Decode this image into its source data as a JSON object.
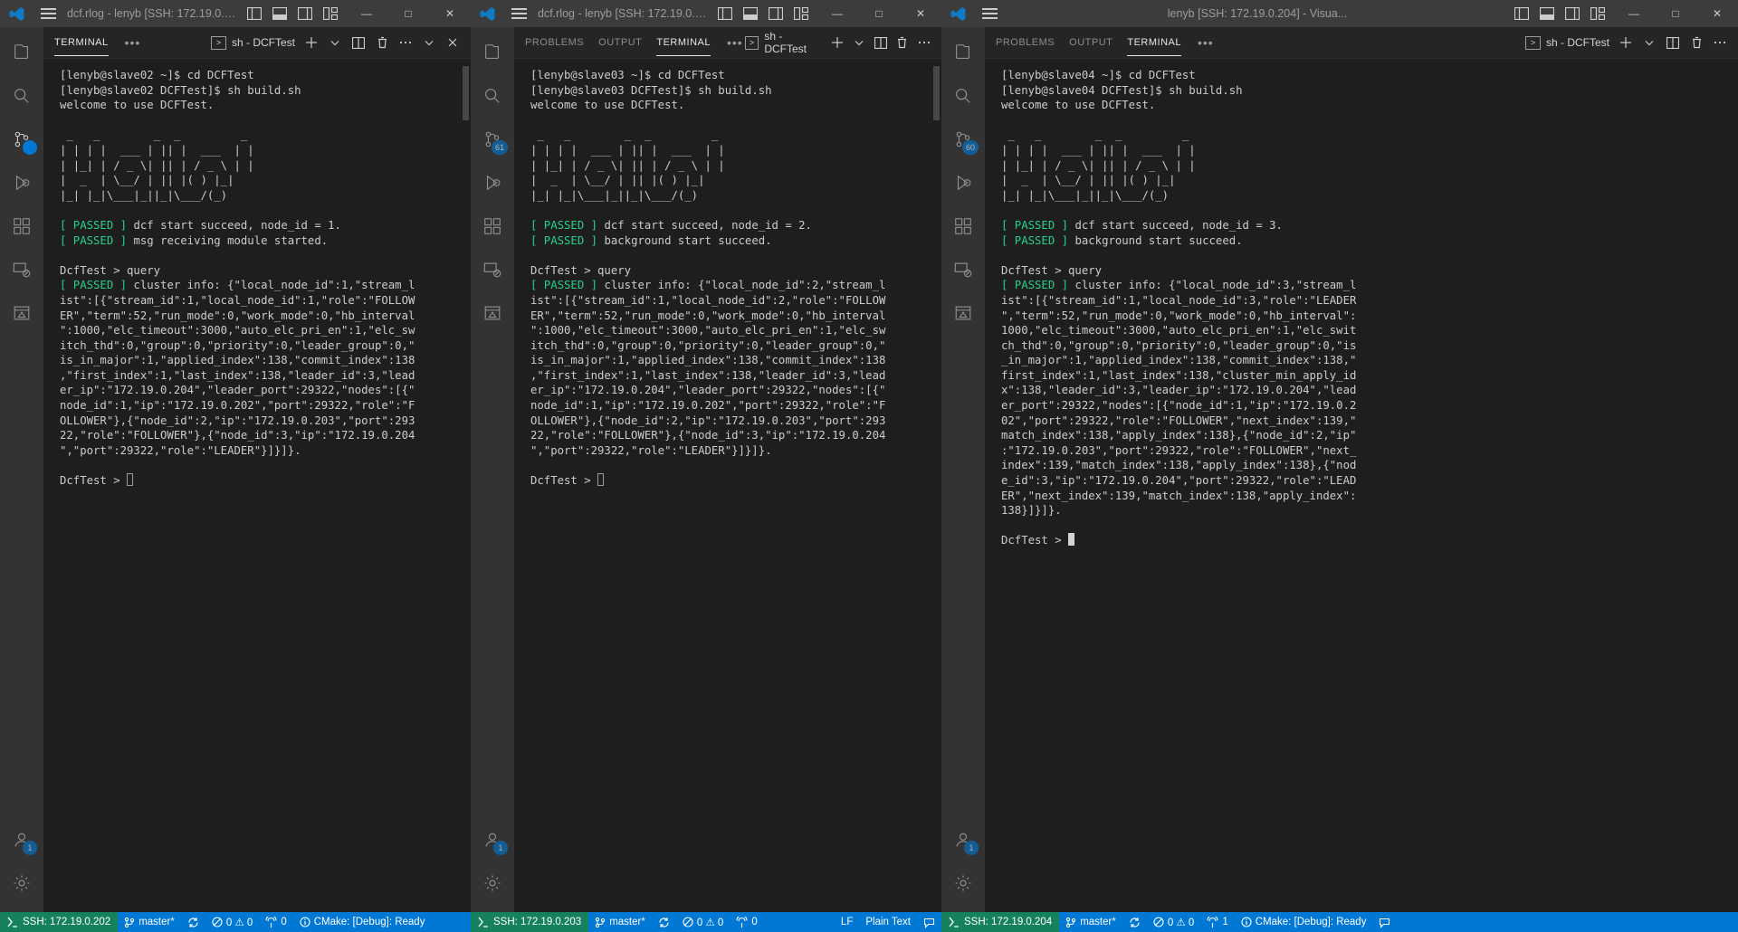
{
  "windows": [
    {
      "id": "win-slave02",
      "title": "dcf.rlog - lenyb [SSH: 172.19.0.20...",
      "panel_tabs": [
        {
          "label": "TERMINAL",
          "active": true
        }
      ],
      "panel_overflow": "•••",
      "shell_label": "sh - DCFTest",
      "terminal": {
        "lines": [
          {
            "gutter": "filled",
            "text": "[lenyb@slave02 ~]$ cd DCFTest"
          },
          {
            "gutter": "hollow",
            "text": "[lenyb@slave02 DCFTest]$ sh build.sh"
          },
          {
            "text": "welcome to use DCFTest."
          },
          {
            "text": ""
          },
          {
            "text": " _   _        _  _         _ "
          },
          {
            "text": "| | | |  ___ | || |  ___  | |"
          },
          {
            "text": "| |_| | / _ \\| || | / _ \\ | |"
          },
          {
            "text": "|  _  | \\__/ | || |( ) |_|"
          },
          {
            "text": "|_| |_|\\___|_||_|\\___/(_)"
          },
          {
            "text": ""
          },
          {
            "passed": true,
            "text": " dcf start succeed, node_id = 1."
          },
          {
            "passed": true,
            "text": " msg receiving module started."
          },
          {
            "text": ""
          },
          {
            "text": "DcfTest > query"
          },
          {
            "passed": true,
            "text": " cluster info: {\"local_node_id\":1,\"stream_l"
          },
          {
            "text": "ist\":[{\"stream_id\":1,\"local_node_id\":1,\"role\":\"FOLLOW"
          },
          {
            "text": "ER\",\"term\":52,\"run_mode\":0,\"work_mode\":0,\"hb_interval"
          },
          {
            "text": "\":1000,\"elc_timeout\":3000,\"auto_elc_pri_en\":1,\"elc_sw"
          },
          {
            "text": "itch_thd\":0,\"group\":0,\"priority\":0,\"leader_group\":0,\""
          },
          {
            "text": "is_in_major\":1,\"applied_index\":138,\"commit_index\":138"
          },
          {
            "text": ",\"first_index\":1,\"last_index\":138,\"leader_id\":3,\"lead"
          },
          {
            "text": "er_ip\":\"172.19.0.204\",\"leader_port\":29322,\"nodes\":[{\""
          },
          {
            "text": "node_id\":1,\"ip\":\"172.19.0.202\",\"port\":29322,\"role\":\"F"
          },
          {
            "text": "OLLOWER\"},{\"node_id\":2,\"ip\":\"172.19.0.203\",\"port\":293"
          },
          {
            "text": "22,\"role\":\"FOLLOWER\"},{\"node_id\":3,\"ip\":\"172.19.0.204"
          },
          {
            "text": "\",\"port\":29322,\"role\":\"LEADER\"}]}]}."
          },
          {
            "text": ""
          },
          {
            "prompt": "DcfTest > ",
            "cursor": "outline"
          }
        ]
      },
      "status": {
        "remote": "SSH: 172.19.0.202",
        "items": [
          {
            "name": "branch",
            "label": "master*"
          },
          {
            "name": "sync",
            "label": ""
          },
          {
            "name": "problems",
            "label": "0 ⚠ 0"
          },
          {
            "name": "ports",
            "label": "0"
          },
          {
            "name": "cmake",
            "label": "CMake: [Debug]: Ready"
          }
        ]
      }
    },
    {
      "id": "win-slave03",
      "title": "dcf.rlog - lenyb [SSH: 172.19.0.20...",
      "panel_tabs": [
        {
          "label": "PROBLEMS",
          "active": false
        },
        {
          "label": "OUTPUT",
          "active": false
        },
        {
          "label": "TERMINAL",
          "active": true
        }
      ],
      "panel_overflow": "•••",
      "shell_label": "sh - DCFTest",
      "scm_badge": "61",
      "terminal": {
        "lines": [
          {
            "gutter": "filled",
            "text": "[lenyb@slave03 ~]$ cd DCFTest"
          },
          {
            "gutter": "hollow",
            "text": "[lenyb@slave03 DCFTest]$ sh build.sh"
          },
          {
            "text": "welcome to use DCFTest."
          },
          {
            "text": ""
          },
          {
            "text": " _   _        _  _         _ "
          },
          {
            "text": "| | | |  ___ | || |  ___  | |"
          },
          {
            "text": "| |_| | / _ \\| || | / _ \\ | |"
          },
          {
            "text": "|  _  | \\__/ | || |( ) |_|"
          },
          {
            "text": "|_| |_|\\___|_||_|\\___/(_)"
          },
          {
            "text": ""
          },
          {
            "passed": true,
            "text": " dcf start succeed, node_id = 2."
          },
          {
            "passed": true,
            "text": " background start succeed."
          },
          {
            "text": ""
          },
          {
            "text": "DcfTest > query"
          },
          {
            "passed": true,
            "text": " cluster info: {\"local_node_id\":2,\"stream_l"
          },
          {
            "text": "ist\":[{\"stream_id\":1,\"local_node_id\":2,\"role\":\"FOLLOW"
          },
          {
            "text": "ER\",\"term\":52,\"run_mode\":0,\"work_mode\":0,\"hb_interval"
          },
          {
            "text": "\":1000,\"elc_timeout\":3000,\"auto_elc_pri_en\":1,\"elc_sw"
          },
          {
            "text": "itch_thd\":0,\"group\":0,\"priority\":0,\"leader_group\":0,\""
          },
          {
            "text": "is_in_major\":1,\"applied_index\":138,\"commit_index\":138"
          },
          {
            "text": ",\"first_index\":1,\"last_index\":138,\"leader_id\":3,\"lead"
          },
          {
            "text": "er_ip\":\"172.19.0.204\",\"leader_port\":29322,\"nodes\":[{\""
          },
          {
            "text": "node_id\":1,\"ip\":\"172.19.0.202\",\"port\":29322,\"role\":\"F"
          },
          {
            "text": "OLLOWER\"},{\"node_id\":2,\"ip\":\"172.19.0.203\",\"port\":293"
          },
          {
            "text": "22,\"role\":\"FOLLOWER\"},{\"node_id\":3,\"ip\":\"172.19.0.204"
          },
          {
            "text": "\",\"port\":29322,\"role\":\"LEADER\"}]}]}."
          },
          {
            "text": ""
          },
          {
            "prompt": "DcfTest > ",
            "cursor": "outline"
          }
        ]
      },
      "status": {
        "remote": "SSH: 172.19.0.203",
        "items": [
          {
            "name": "branch",
            "label": "master*"
          },
          {
            "name": "sync",
            "label": ""
          },
          {
            "name": "problems",
            "label": "0 ⚠ 0"
          },
          {
            "name": "ports",
            "label": "0"
          }
        ],
        "right_items": [
          {
            "name": "eol",
            "label": "LF"
          },
          {
            "name": "language",
            "label": "Plain Text"
          },
          {
            "name": "feedback",
            "label": ""
          }
        ]
      }
    },
    {
      "id": "win-slave04",
      "title": "lenyb [SSH: 172.19.0.204] - Visua...",
      "panel_tabs": [
        {
          "label": "PROBLEMS",
          "active": false
        },
        {
          "label": "OUTPUT",
          "active": false
        },
        {
          "label": "TERMINAL",
          "active": true
        }
      ],
      "panel_overflow": "•••",
      "shell_label": "sh - DCFTest",
      "scm_badge": "60",
      "terminal": {
        "lines": [
          {
            "gutter": "filled",
            "text": "[lenyb@slave04 ~]$ cd DCFTest"
          },
          {
            "gutter": "hollow",
            "text": "[lenyb@slave04 DCFTest]$ sh build.sh"
          },
          {
            "text": "welcome to use DCFTest."
          },
          {
            "text": ""
          },
          {
            "text": " _   _        _  _         _ "
          },
          {
            "text": "| | | |  ___ | || |  ___  | |"
          },
          {
            "text": "| |_| | / _ \\| || | / _ \\ | |"
          },
          {
            "text": "|  _  | \\__/ | || |( ) |_|"
          },
          {
            "text": "|_| |_|\\___|_||_|\\___/(_)"
          },
          {
            "text": ""
          },
          {
            "passed": true,
            "text": " dcf start succeed, node_id = 3."
          },
          {
            "passed": true,
            "text": " background start succeed."
          },
          {
            "text": ""
          },
          {
            "text": "DcfTest > query"
          },
          {
            "passed": true,
            "text": " cluster info: {\"local_node_id\":3,\"stream_l"
          },
          {
            "text": "ist\":[{\"stream_id\":1,\"local_node_id\":3,\"role\":\"LEADER"
          },
          {
            "text": "\",\"term\":52,\"run_mode\":0,\"work_mode\":0,\"hb_interval\":"
          },
          {
            "text": "1000,\"elc_timeout\":3000,\"auto_elc_pri_en\":1,\"elc_swit"
          },
          {
            "text": "ch_thd\":0,\"group\":0,\"priority\":0,\"leader_group\":0,\"is"
          },
          {
            "text": "_in_major\":1,\"applied_index\":138,\"commit_index\":138,\""
          },
          {
            "text": "first_index\":1,\"last_index\":138,\"cluster_min_apply_id"
          },
          {
            "text": "x\":138,\"leader_id\":3,\"leader_ip\":\"172.19.0.204\",\"lead"
          },
          {
            "text": "er_port\":29322,\"nodes\":[{\"node_id\":1,\"ip\":\"172.19.0.2"
          },
          {
            "text": "02\",\"port\":29322,\"role\":\"FOLLOWER\",\"next_index\":139,\""
          },
          {
            "text": "match_index\":138,\"apply_index\":138},{\"node_id\":2,\"ip\""
          },
          {
            "text": ":\"172.19.0.203\",\"port\":29322,\"role\":\"FOLLOWER\",\"next_"
          },
          {
            "text": "index\":139,\"match_index\":138,\"apply_index\":138},{\"nod"
          },
          {
            "text": "e_id\":3,\"ip\":\"172.19.0.204\",\"port\":29322,\"role\":\"LEAD"
          },
          {
            "text": "ER\",\"next_index\":139,\"match_index\":138,\"apply_index\":"
          },
          {
            "text": "138}]}]}."
          },
          {
            "text": ""
          },
          {
            "prompt": "DcfTest > ",
            "cursor": "filled"
          }
        ]
      },
      "status": {
        "remote": "SSH: 172.19.0.204",
        "items": [
          {
            "name": "branch",
            "label": "master*"
          },
          {
            "name": "sync",
            "label": ""
          },
          {
            "name": "problems",
            "label": "0 ⚠ 0"
          },
          {
            "name": "ports",
            "label": "1"
          },
          {
            "name": "cmake",
            "label": "CMake: [Debug]: Ready"
          }
        ]
      }
    }
  ],
  "activity_icons": [
    "explorer-icon",
    "search-icon",
    "source-control-icon",
    "run-debug-icon",
    "extensions-icon",
    "remote-explorer-icon",
    "testing-icon"
  ],
  "activity_bottom_icons": [
    "accounts-icon",
    "settings-gear-icon"
  ],
  "titlebar_controls": [
    "minimize",
    "maximize",
    "close"
  ],
  "colors": {
    "accent_blue": "#0078d4",
    "remote_green": "#16825d",
    "passed_green": "#23d18b",
    "titlebar_bg": "#3c3c3c",
    "activitybar_bg": "#333333",
    "terminal_bg": "#1e1e1e",
    "text": "#cccccc"
  }
}
